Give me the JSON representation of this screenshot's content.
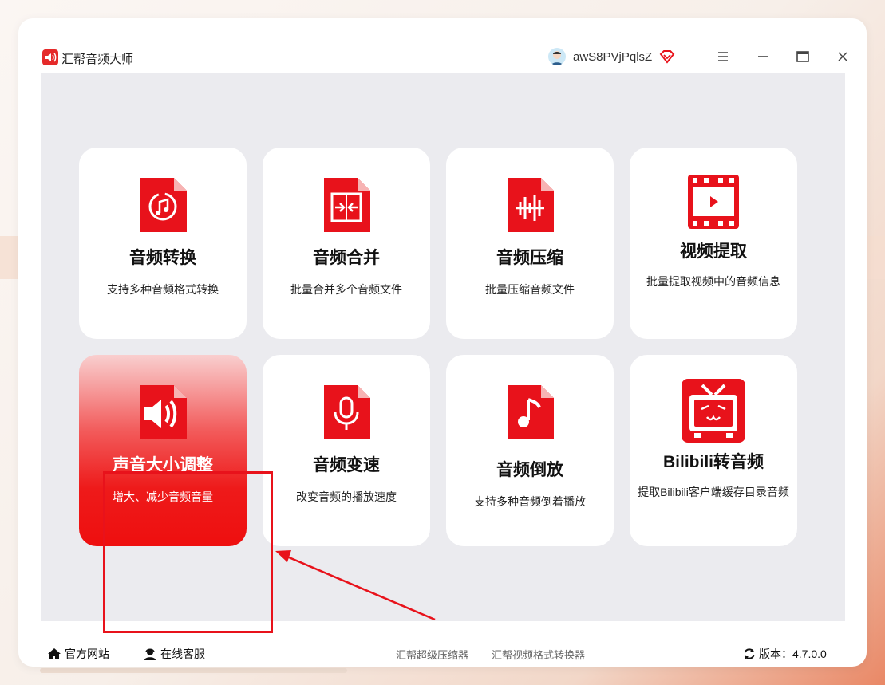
{
  "app": {
    "title": "汇帮音频大师",
    "username": "awS8PVjPqlsZ"
  },
  "colors": {
    "brand_red": "#e52a2a",
    "content_bg": "#ebebef",
    "annotation_red": "#e8121b"
  },
  "cards": [
    {
      "title": "音频转换",
      "desc": "支持多种音频格式转换",
      "icon": "audio-convert-icon"
    },
    {
      "title": "音频合并",
      "desc": "批量合并多个音频文件",
      "icon": "audio-merge-icon"
    },
    {
      "title": "音频压缩",
      "desc": "批量压缩音频文件",
      "icon": "audio-compress-icon"
    },
    {
      "title": "视频提取",
      "desc": "批量提取视频中的音频信息",
      "icon": "video-extract-icon"
    },
    {
      "title": "声音大小调整",
      "desc": "增大、减少音频音量",
      "icon": "volume-adjust-icon",
      "active": true
    },
    {
      "title": "音频变速",
      "desc": "改变音频的播放速度",
      "icon": "microphone-icon"
    },
    {
      "title": "音频倒放",
      "desc": "支持多种音频倒着播放",
      "icon": "music-note-icon"
    },
    {
      "title": "Bilibili转音频",
      "desc": "提取Bilibili客户端缓存目录音频",
      "icon": "bilibili-tv-icon"
    }
  ],
  "footer": {
    "website": "官方网站",
    "support": "在线客服",
    "link1": "汇帮超级压缩器",
    "link2": "汇帮视频格式转换器",
    "version": "版本：4.7.0.0"
  }
}
